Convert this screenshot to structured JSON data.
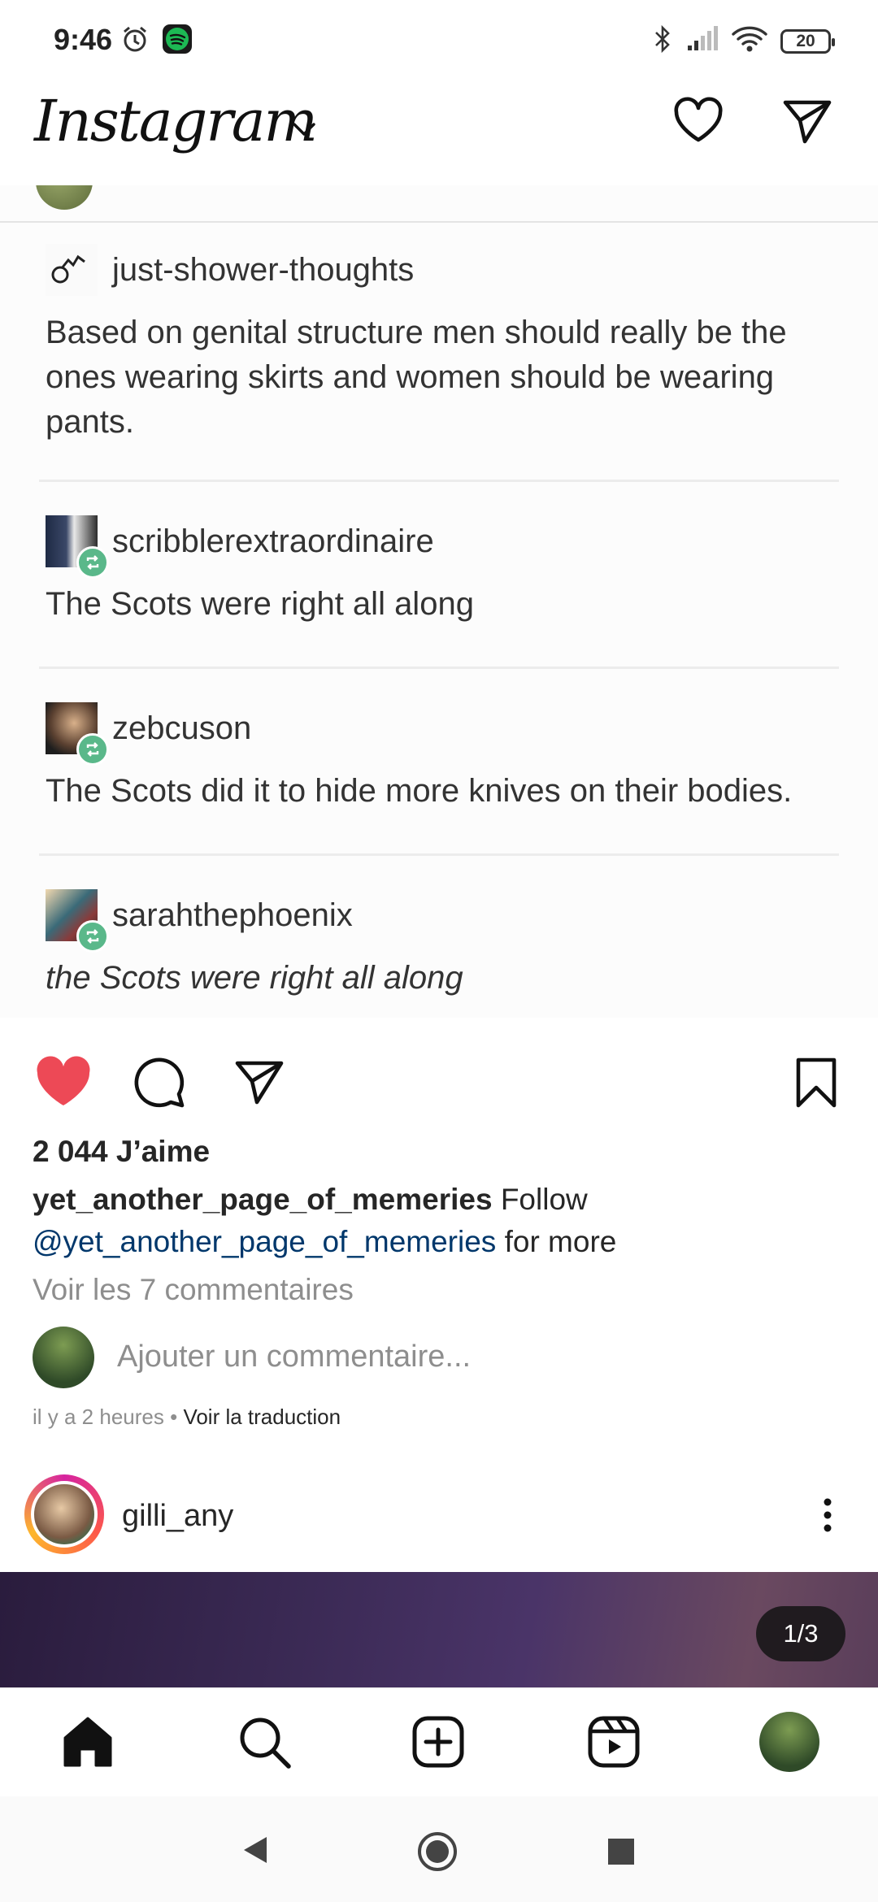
{
  "status_bar": {
    "time": "9:46",
    "battery": "20"
  },
  "header": {
    "logo": "Instagram"
  },
  "post": {
    "tumblr": [
      {
        "user": "just-shower-thoughts",
        "text": "Based on genital structure men should really be the ones wearing skirts and women should be wearing pants."
      },
      {
        "user": "scribblerextraordinaire",
        "text": "The Scots were right all along"
      },
      {
        "user": "zebcuson",
        "text": "The Scots did it to hide more knives on their bodies."
      },
      {
        "user": "sarahthephoenix",
        "text": "the Scots were right all along"
      }
    ],
    "likes": "2 044 J’aime",
    "caption_user": "yet_another_page_of_memeries",
    "caption_text_1": " Follow",
    "caption_mention": "@yet_another_page_of_memeries",
    "caption_text_2": " for more",
    "view_comments": "Voir les 7 commentaires",
    "comment_placeholder": "Ajouter un commentaire...",
    "time_ago": "il y a 2 heures",
    "meta_sep": " • ",
    "translate": "Voir la traduction"
  },
  "next_post": {
    "user": "gilli_any",
    "counter": "1/3"
  },
  "icons": {
    "alarm": "alarm-icon",
    "spotify": "spotify-icon",
    "bluetooth": "bluetooth-icon",
    "signal": "signal-icon",
    "wifi": "wifi-icon",
    "heart": "heart-icon",
    "dm": "paper-plane-icon",
    "like_filled": "heart-filled-icon",
    "comment": "comment-icon",
    "share": "paper-plane-icon",
    "save": "bookmark-icon",
    "more": "more-vertical-icon",
    "home": "home-icon",
    "search": "search-icon",
    "create": "plus-square-icon",
    "reels": "reels-icon",
    "back": "back-triangle-icon",
    "home_sys": "home-circle-icon",
    "recents": "recents-square-icon"
  },
  "colors": {
    "like": "#ed4956",
    "mention": "#00376b",
    "secondary": "#8e8e8e",
    "reblog": "#5ab88a"
  }
}
